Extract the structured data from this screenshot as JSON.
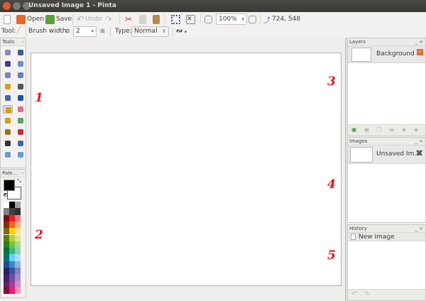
{
  "window": {
    "title": "Unsaved Image 1 - Pinta"
  },
  "toolbar": {
    "new_icon": "new-image-icon",
    "open_label": "Open",
    "save_label": "Save",
    "undo_label": "Undo",
    "zoom_value": "100%",
    "image_size": "724, 548"
  },
  "toolbar2": {
    "tool_label": "Tool:",
    "brush_width_label": "Brush width:",
    "brush_width_value": "2",
    "type_label": "Type:",
    "type_value": "Normal"
  },
  "tools_panel": {
    "title": "Tools",
    "menu": "-"
  },
  "palette_panel": {
    "title": "Pale...",
    "menu": "-",
    "primary_color": "#000000",
    "secondary_color": "#ffffff",
    "colors": [
      [
        "#ffffff",
        "#000000",
        "#a0a0a0"
      ],
      [
        "#808080",
        "#404040",
        "#303030"
      ],
      [
        "#7f0e14",
        "#ee1c24",
        "#f5777a"
      ],
      [
        "#7f3300",
        "#f26522",
        "#f9ad81"
      ],
      [
        "#7f6a00",
        "#ffd200",
        "#fde68a"
      ],
      [
        "#5b7f00",
        "#b5d334",
        "#d9e88c"
      ],
      [
        "#2a7f1a",
        "#7ac143",
        "#a8d58a"
      ],
      [
        "#00733b",
        "#3cb878",
        "#8ed2ae"
      ],
      [
        "#007279",
        "#6dcff6",
        "#a7dfef"
      ],
      [
        "#1b4f8a",
        "#4783c4",
        "#8fb3de"
      ],
      [
        "#262262",
        "#3f4fa0",
        "#8080c0"
      ],
      [
        "#3d1e6f",
        "#6f4fa0",
        "#a38bc3"
      ],
      [
        "#6e1a65",
        "#a63d99",
        "#cf8cc4"
      ],
      [
        "#7f0e3b",
        "#ec1c79",
        "#f497b8"
      ]
    ]
  },
  "layers_panel": {
    "title": "Layers",
    "controls": "_ ×",
    "layers": [
      {
        "name": "Background",
        "visible": true
      }
    ]
  },
  "images_panel": {
    "title": "Images",
    "controls": "_ ×",
    "images": [
      {
        "name": "Unsaved Im..."
      }
    ]
  },
  "history_panel": {
    "title": "History",
    "controls": "_ ×",
    "items": [
      {
        "name": "New Image"
      }
    ]
  },
  "annotations": [
    "1",
    "2",
    "3",
    "4",
    "5"
  ],
  "colors": {
    "titlebar": "#3c3b37",
    "close": "#e9552c",
    "annotation": "#e8131b"
  }
}
